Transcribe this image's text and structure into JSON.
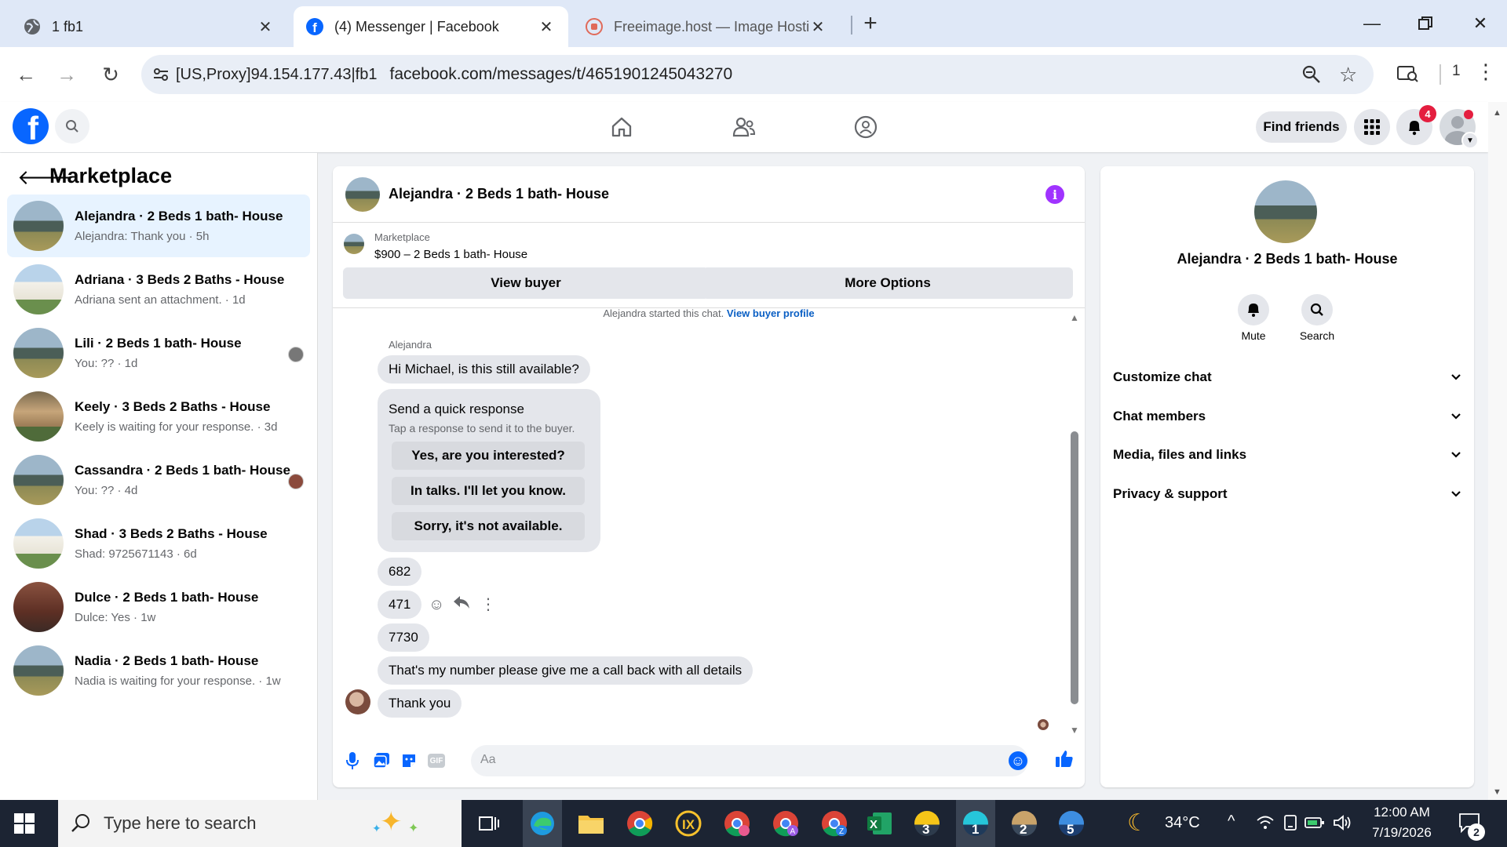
{
  "browser": {
    "tabs": [
      {
        "title": "1 fb1",
        "active": false
      },
      {
        "title": "(4) Messenger | Facebook",
        "active": true
      },
      {
        "title": "Freeimage.host — Image Hosti",
        "active": false
      }
    ],
    "proxy_label": "[US,Proxy]94.154.177.43|fb1",
    "url": "facebook.com/messages/t/4651901245043270",
    "extensions_count": "1"
  },
  "header": {
    "find_friends_label": "Find friends",
    "notification_count": "4"
  },
  "sidebar": {
    "title": "Marketplace",
    "conversations": [
      {
        "name": "Alejandra · 2 Beds 1 bath- House",
        "snippet": "Alejandra: Thank you · 5h",
        "selected": true
      },
      {
        "name": "Adriana · 3 Beds 2 Baths - House",
        "snippet": "Adriana sent an attachment. · 1d"
      },
      {
        "name": "Lili · 2 Beds 1 bath- House",
        "snippet": "You: ?? · 1d"
      },
      {
        "name": "Keely · 3 Beds 2 Baths - House",
        "snippet": "Keely is waiting for your response. · 3d"
      },
      {
        "name": "Cassandra · 2 Beds 1 bath- House",
        "snippet": "You: ?? · 4d"
      },
      {
        "name": "Shad · 3 Beds 2 Baths - House",
        "snippet": "Shad: 9725671143 · 6d"
      },
      {
        "name": "Dulce · 2 Beds 1 bath- House",
        "snippet": "Dulce: Yes · 1w"
      },
      {
        "name": "Nadia · 2 Beds 1 bath- House",
        "snippet": "Nadia is waiting for your response. · 1w"
      }
    ]
  },
  "chat": {
    "title": "Alejandra · 2 Beds 1 bath- House",
    "listing_source": "Marketplace",
    "listing_title": "$900 – 2 Beds 1 bath- House",
    "view_buyer_label": "View buyer",
    "more_options_label": "More Options",
    "started_text": "Alejandra started this chat.",
    "buyer_profile_link": "View buyer profile",
    "sender_name": "Alejandra",
    "messages": [
      "Hi Michael, is this still available?",
      "682",
      "471",
      "7730",
      "That's my number please give me a call back with all details",
      "Thank you"
    ],
    "quick_response": {
      "title": "Send a quick response",
      "subtitle": "Tap a response to send it to the buyer.",
      "options": [
        "Yes, are you interested?",
        "In talks. I'll let you know.",
        "Sorry, it's not available."
      ]
    },
    "composer_placeholder": "Aa"
  },
  "info_panel": {
    "name": "Alejandra · 2 Beds 1 bath- House",
    "mute_label": "Mute",
    "search_label": "Search",
    "sections": [
      "Customize chat",
      "Chat members",
      "Media, files and links",
      "Privacy & support"
    ]
  },
  "taskbar": {
    "search_placeholder": "Type here to search",
    "weather": "34°C",
    "time": "12:00 AM",
    "date": "7/19/2026",
    "notification_badge": "2",
    "badges": [
      "3",
      "1",
      "2",
      "5"
    ]
  },
  "colors": {
    "facebook_blue": "#0866ff",
    "messenger_purple": "#a033ff",
    "selected_bg": "#e7f3ff",
    "notification_red": "#e41e3f"
  }
}
